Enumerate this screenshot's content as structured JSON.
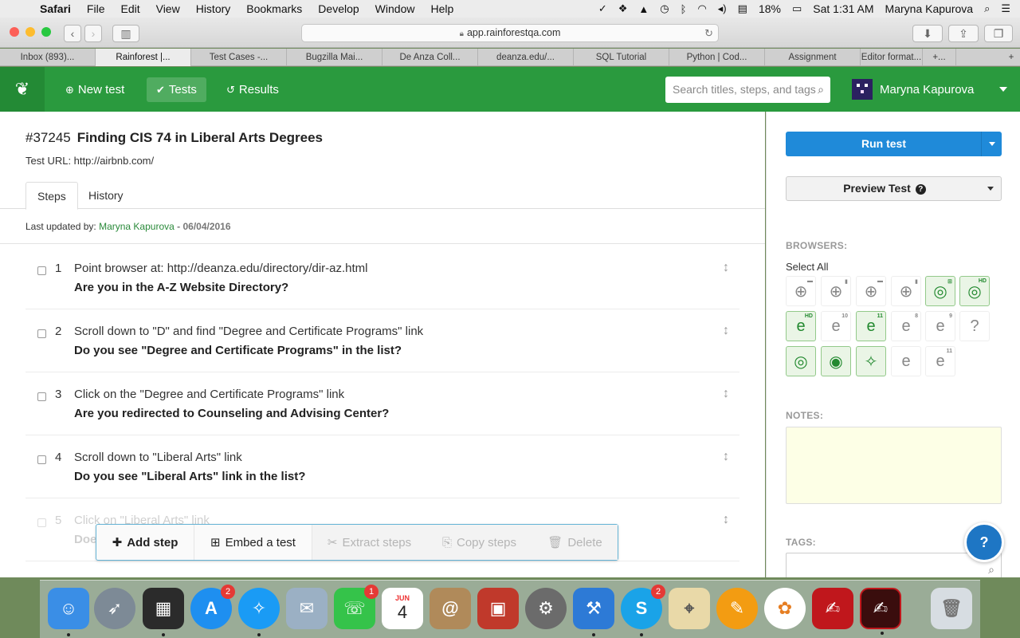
{
  "menubar": {
    "app": "Safari",
    "items": [
      "File",
      "Edit",
      "View",
      "History",
      "Bookmarks",
      "Develop",
      "Window",
      "Help"
    ],
    "battery": "18%",
    "time": "Sat 1:31 AM",
    "user": "Maryna Kapurova"
  },
  "browser": {
    "url": "app.rainforestqa.com",
    "tabs": [
      "Inbox (893)...",
      "Rainforest |...",
      "Test Cases -...",
      "Bugzilla Mai...",
      "De Anza Coll...",
      "deanza.edu/...",
      "SQL Tutorial",
      "Python | Cod...",
      "Assignment",
      "Editor format...",
      "+..."
    ]
  },
  "app": {
    "nav": {
      "new_test": "New test",
      "tests": "Tests",
      "results": "Results"
    },
    "search_placeholder": "Search titles, steps, and tags",
    "user_name": "Maryna Kapurova"
  },
  "test": {
    "id": "#37245",
    "title": "Finding CIS 74 in Liberal Arts Degrees",
    "url_label": "Test URL: http://airbnb.com/",
    "tabs": {
      "steps": "Steps",
      "history": "History"
    },
    "last_updated_prefix": "Last updated by:",
    "last_updated_by": "Maryna Kapurova",
    "last_updated_sep": " - ",
    "last_updated_date": "06/04/2016",
    "steps": [
      {
        "n": "1",
        "action": "Point browser at: http://deanza.edu/directory/dir-az.html",
        "question": "Are you in the A-Z Website Directory?"
      },
      {
        "n": "2",
        "action": "Scroll down to \"D\" and find \"Degree and Certificate Programs\" link",
        "question": "Do you see \"Degree and Certificate Programs\" in the list?"
      },
      {
        "n": "3",
        "action": "Click on the \"Degree and Certificate Programs\" link",
        "question": "Are you redirected to Counseling and Advising Center?"
      },
      {
        "n": "4",
        "action": "Scroll down to \"Liberal Arts\" link",
        "question": "Do you see \"Liberal Arts\" link in the list?"
      },
      {
        "n": "5",
        "action": "Click on \"Liberal Arts\" link",
        "question": "Doe"
      }
    ],
    "actions": {
      "add_step": "Add step",
      "embed": "Embed a test",
      "extract": "Extract steps",
      "copy": "Copy steps",
      "delete": "Delete"
    }
  },
  "sidebar": {
    "run_test": "Run test",
    "preview_test": "Preview Test",
    "browsers_label": "BROWSERS:",
    "select_all": "Select All",
    "notes_label": "NOTES:",
    "tags_label": "TAGS:"
  },
  "dock_badges": {
    "app_store": "2",
    "facetime": "1",
    "skype": "2",
    "calendar_month": "JUN",
    "calendar_day": "4"
  },
  "colors": {
    "green": "#2a9a3e",
    "blue": "#1f8ad9",
    "notes_bg": "#fdffe6"
  }
}
